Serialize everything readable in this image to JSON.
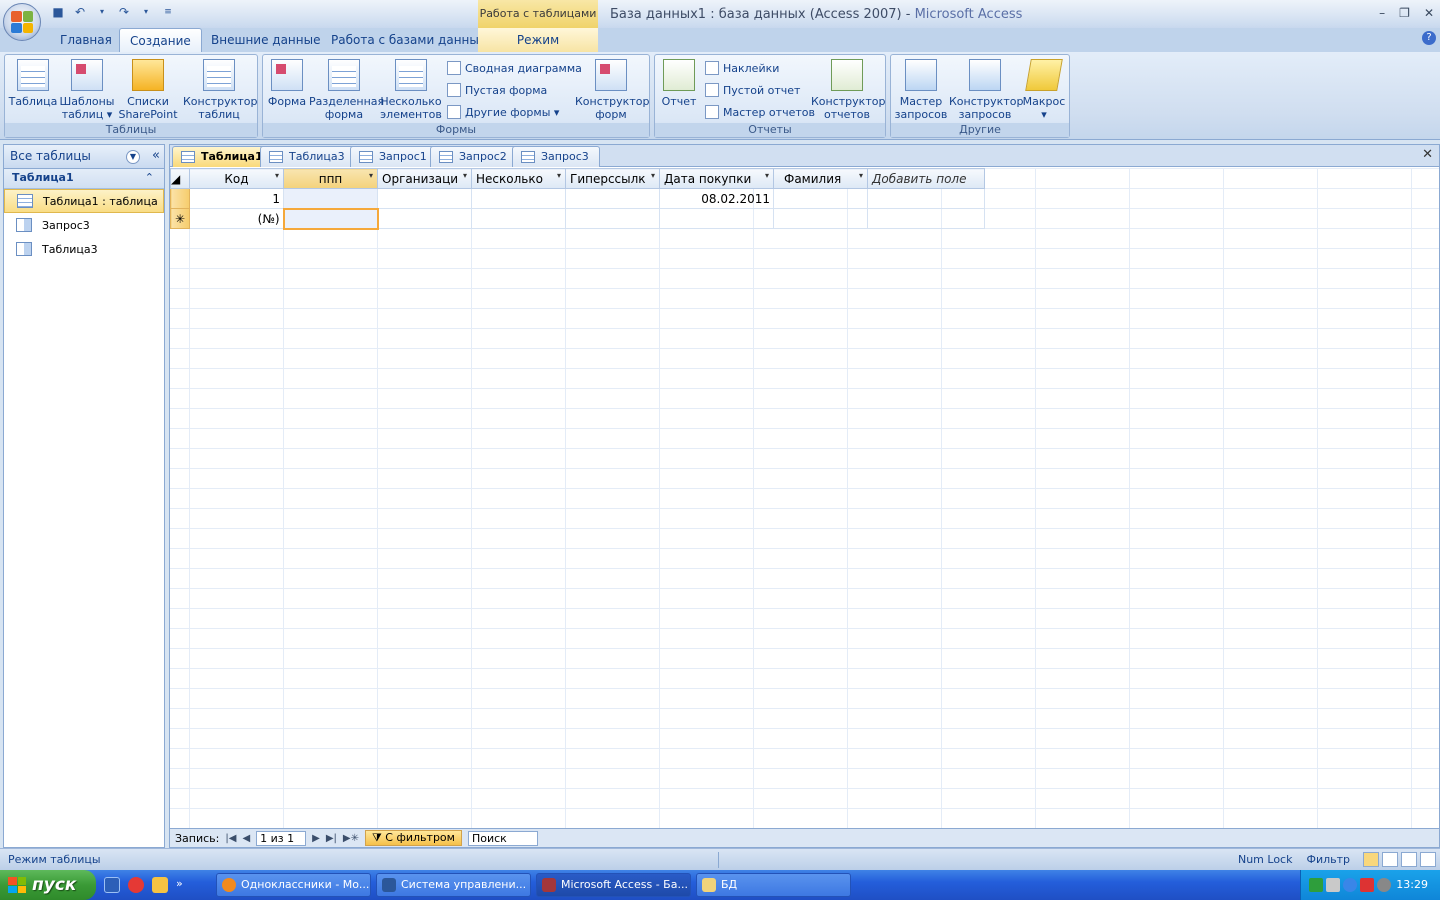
{
  "window": {
    "title": "База данных1 : база данных (Access 2007)",
    "title_sep": " - ",
    "app_name": "Microsoft Access",
    "context_tab_header": "Работа с таблицами"
  },
  "ribbon": {
    "tabs": [
      "Главная",
      "Создание",
      "Внешние данные",
      "Работа с базами данных",
      "Режим таблицы"
    ],
    "active_tab": "Создание",
    "groups": {
      "tables": {
        "label": "Таблицы",
        "buttons": [
          {
            "l1": "Таблица",
            "l2": ""
          },
          {
            "l1": "Шаблоны",
            "l2": "таблиц ▾"
          },
          {
            "l1": "Списки",
            "l2": "SharePoint ▾"
          },
          {
            "l1": "Конструктор",
            "l2": "таблиц"
          }
        ]
      },
      "forms": {
        "label": "Формы",
        "buttons": [
          {
            "l1": "Форма",
            "l2": ""
          },
          {
            "l1": "Разделенная",
            "l2": "форма"
          },
          {
            "l1": "Несколько",
            "l2": "элементов"
          },
          {
            "l1": "Конструктор",
            "l2": "форм"
          }
        ],
        "small": [
          "Сводная диаграмма",
          "Пустая форма",
          "Другие формы ▾"
        ]
      },
      "reports": {
        "label": "Отчеты",
        "buttons": [
          {
            "l1": "Отчет",
            "l2": ""
          },
          {
            "l1": "Конструктор",
            "l2": "отчетов"
          }
        ],
        "small": [
          "Наклейки",
          "Пустой отчет",
          "Мастер отчетов"
        ]
      },
      "other": {
        "label": "Другие",
        "buttons": [
          {
            "l1": "Мастер",
            "l2": "запросов"
          },
          {
            "l1": "Конструктор",
            "l2": "запросов"
          },
          {
            "l1": "Макрос",
            "l2": "▾"
          }
        ]
      }
    }
  },
  "nav": {
    "header": "Все таблицы",
    "group": "Таблица1",
    "items": [
      "Таблица1 : таблица",
      "Запрос3",
      "Таблица3"
    ]
  },
  "doc_tabs": [
    "Таблица1",
    "Таблица3",
    "Запрос1",
    "Запрос2",
    "Запрос3"
  ],
  "datasheet": {
    "columns": [
      "Код",
      "ппп",
      "Организаци",
      "Несколько",
      "Гиперссылк",
      "Дата покупки",
      "Фамилия",
      "Добавить поле"
    ],
    "rows": [
      [
        "1",
        "",
        "",
        "",
        "",
        "08.02.2011",
        "",
        ""
      ],
      [
        "(№)",
        "",
        "",
        "",
        "",
        "",
        "",
        ""
      ]
    ],
    "new_row_marker": "✳"
  },
  "record_nav": {
    "label": "Запись:",
    "position": "1 из 1",
    "filter": "С фильтром",
    "search": "Поиск"
  },
  "status": {
    "left": "Режим таблицы",
    "num_lock": "Num Lock",
    "filter": "Фильтр"
  },
  "taskbar": {
    "start": "пуск",
    "buttons": [
      "Одноклассники - Mo...",
      "Система управлени...",
      "Microsoft Access - Ба...",
      "БД"
    ],
    "clock": "13:29"
  },
  "colors": {
    "accent": "#15428b",
    "selection": "#f9dd85",
    "focus_border": "#f5a83a"
  }
}
